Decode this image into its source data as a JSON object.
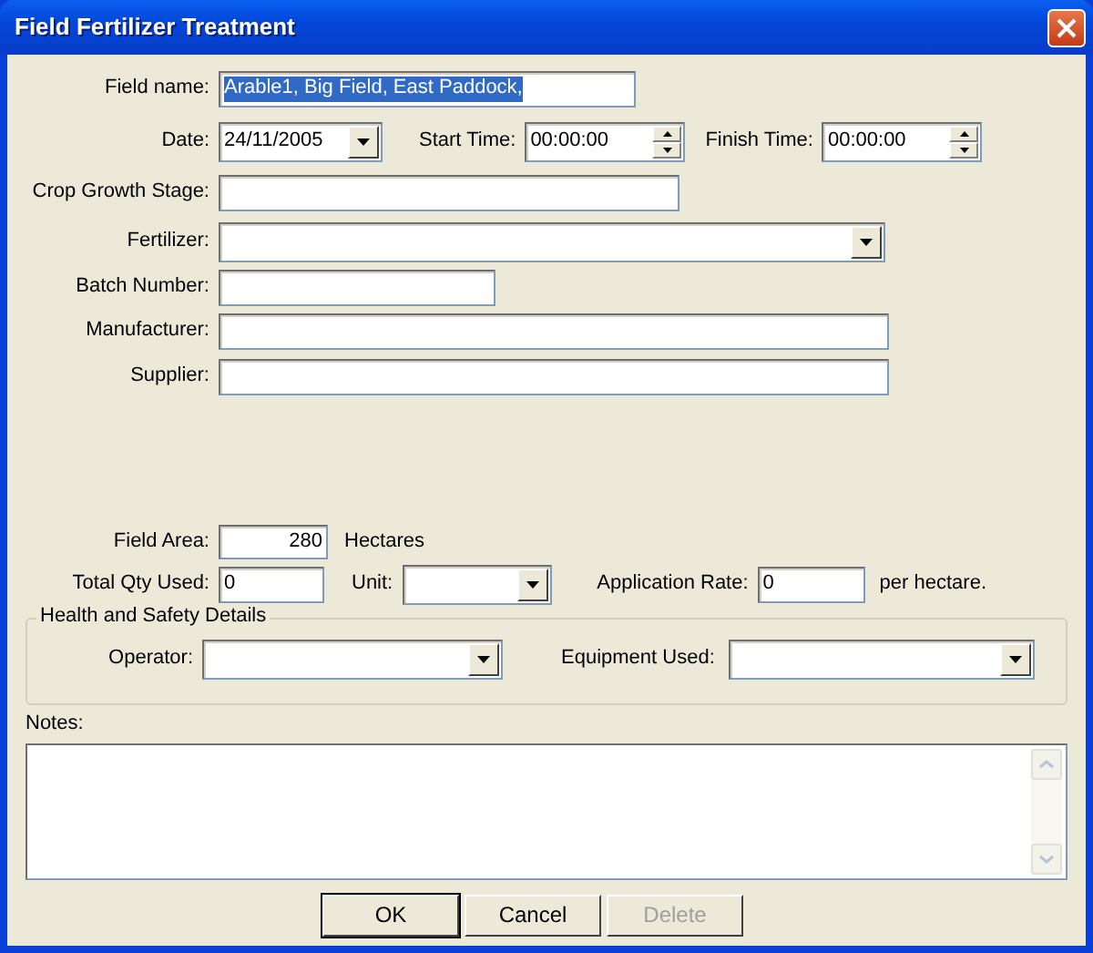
{
  "window": {
    "title": "Field Fertilizer Treatment"
  },
  "field_name": {
    "label": "Field name:",
    "value": "Arable1, Big Field, East Paddock,",
    "selected": true
  },
  "date": {
    "label": "Date:",
    "value": "24/11/2005"
  },
  "start_time": {
    "label": "Start Time:",
    "value": "00:00:00"
  },
  "finish_time": {
    "label": "Finish Time:",
    "value": "00:00:00"
  },
  "details": [
    {
      "label": "Crop Growth Stage:",
      "kind": "text"
    },
    {
      "label": "Fertilizer:",
      "kind": "combo"
    },
    {
      "label": "Batch Number:",
      "kind": "text"
    },
    {
      "label": "Manufacturer:",
      "kind": "text"
    },
    {
      "label": "Supplier:",
      "kind": "text"
    }
  ],
  "field_area": {
    "label": "Field Area:",
    "value": "280",
    "unit": "Hectares"
  },
  "total_qty": {
    "label": "Total Qty Used:",
    "value": "0"
  },
  "unit": {
    "label": "Unit:"
  },
  "application_rate": {
    "label": "Application Rate:",
    "value": "0",
    "suffix": "per hectare."
  },
  "health_and_safety": {
    "title": "Health and Safety Details",
    "operator": {
      "label": "Operator:"
    },
    "equipment": {
      "label": "Equipment Used:"
    }
  },
  "notes": {
    "label": "Notes:"
  },
  "buttons": [
    {
      "label": "OK",
      "default": true,
      "disabled": false
    },
    {
      "label": "Cancel",
      "default": false,
      "disabled": false
    },
    {
      "label": "Delete",
      "default": false,
      "disabled": true
    }
  ]
}
